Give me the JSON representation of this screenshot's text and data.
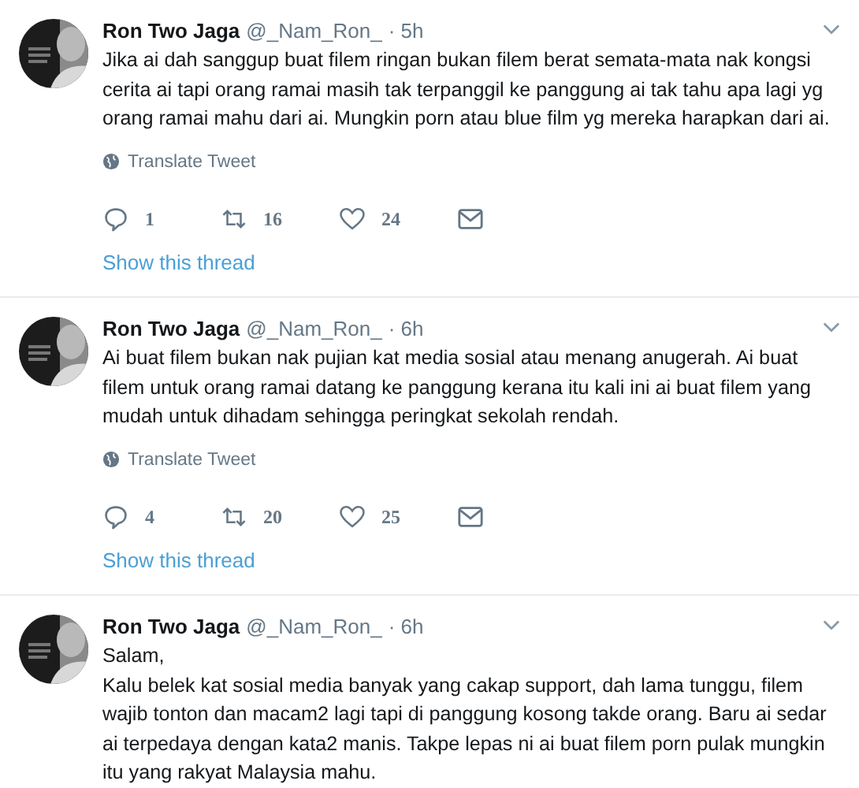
{
  "tweets": [
    {
      "name": "Ron Two Jaga",
      "handle": "@_Nam_Ron_",
      "time": "· 5h",
      "text": "Jika ai dah sanggup buat filem ringan  bukan filem berat semata-mata nak kongsi cerita ai tapi orang ramai masih tak terpanggil ke panggung ai tak tahu apa lagi yg orang ramai mahu dari ai. Mungkin porn atau blue film yg mereka harapkan dari ai.",
      "translate": "Translate Tweet",
      "replies": "1",
      "retweets": "16",
      "likes": "24",
      "thread_link": "Show this thread"
    },
    {
      "name": "Ron Two Jaga",
      "handle": "@_Nam_Ron_",
      "time": "· 6h",
      "text": "Ai buat filem bukan nak pujian kat media sosial atau menang anugerah. Ai buat filem untuk orang ramai datang ke panggung kerana itu kali ini ai buat filem yang mudah untuk dihadam sehingga peringkat sekolah rendah.",
      "translate": "Translate Tweet",
      "replies": "4",
      "retweets": "20",
      "likes": "25",
      "thread_link": "Show this thread"
    },
    {
      "name": "Ron Two Jaga",
      "handle": "@_Nam_Ron_",
      "time": "· 6h",
      "text": "Salam,\nKalu belek kat sosial media banyak yang cakap support, dah lama tunggu, filem wajib tonton dan macam2 lagi tapi di panggung kosong takde orang. Baru ai sedar ai terpedaya dengan kata2 manis. Takpe lepas ni ai buat filem porn pulak mungkin itu yang rakyat Malaysia mahu."
    }
  ]
}
